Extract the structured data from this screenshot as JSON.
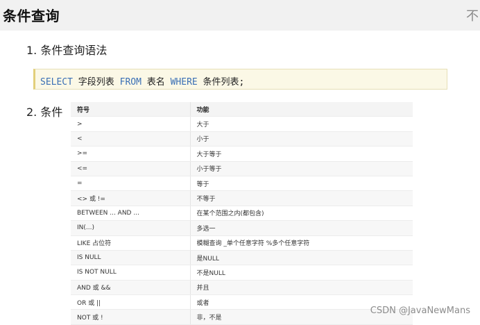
{
  "header": {
    "title": "条件查询",
    "corner_glyph": "不"
  },
  "section1": {
    "heading": "1. 条件查询语法",
    "code": {
      "kw_select": "SELECT",
      "t1": " 字段列表 ",
      "kw_from": "FROM",
      "t2": " 表名 ",
      "kw_where": "WHERE",
      "t3": " 条件列表;"
    }
  },
  "section2": {
    "heading": "2. 条件",
    "table": {
      "headers": [
        "符号",
        "功能"
      ],
      "rows": [
        [
          ">",
          "大于"
        ],
        [
          "<",
          "小于"
        ],
        [
          ">=",
          "大于等于"
        ],
        [
          "<=",
          "小于等于"
        ],
        [
          "=",
          "等于"
        ],
        [
          "<> 或 !=",
          "不等于"
        ],
        [
          "BETWEEN ... AND ...",
          "在某个范围之内(都包含)"
        ],
        [
          "IN(...)",
          "多选一"
        ],
        [
          "LIKE 占位符",
          "模糊查询 _单个任意字符 %多个任意字符"
        ],
        [
          "IS NULL",
          "是NULL"
        ],
        [
          "IS NOT NULL",
          "不是NULL"
        ],
        [
          "AND 或 &&",
          "并且"
        ],
        [
          "OR 或 ||",
          "或者"
        ],
        [
          "NOT 或 !",
          "非，不是"
        ]
      ]
    }
  },
  "watermark": "CSDN @JavaNewMans"
}
